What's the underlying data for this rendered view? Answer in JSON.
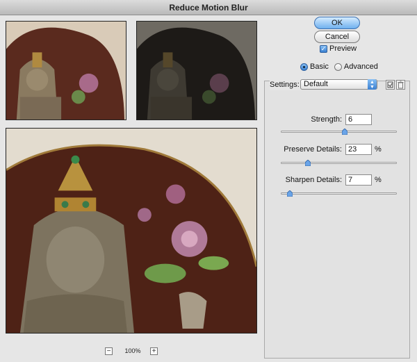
{
  "window": {
    "title": "Reduce Motion Blur"
  },
  "preview": {
    "zoom": "100%",
    "zoom_out": "−",
    "zoom_in": "+"
  },
  "buttons": {
    "ok": "OK",
    "cancel": "Cancel"
  },
  "preview_toggle": {
    "label": "Preview",
    "checked": true
  },
  "mode": {
    "basic": "Basic",
    "advanced": "Advanced",
    "selected": "Basic"
  },
  "settings": {
    "label": "Settings:",
    "value": "Default"
  },
  "sliders": [
    {
      "label": "Strength:",
      "value": "6",
      "unit": "",
      "position": 0.55
    },
    {
      "label": "Preserve Details:",
      "value": "23",
      "unit": "%",
      "position": 0.23
    },
    {
      "label": "Sharpen Details:",
      "value": "7",
      "unit": "%",
      "position": 0.07
    }
  ],
  "colors": {
    "accent": "#3a7fd0",
    "background": "#e6e6e6"
  },
  "icons": {
    "save": "save-settings-icon",
    "delete": "trash-icon"
  }
}
